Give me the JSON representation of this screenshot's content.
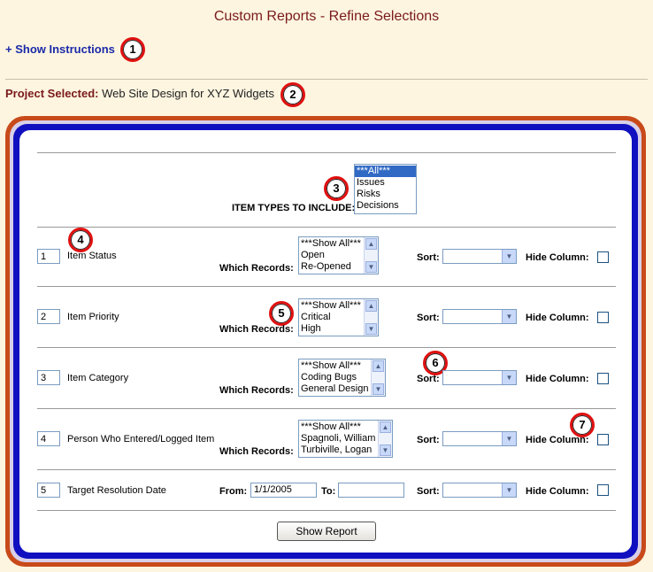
{
  "page": {
    "title": "Custom Reports - Refine Selections",
    "show_instructions": "+ Show Instructions",
    "project_label": "Project Selected:",
    "project_value": "Web Site Design for XYZ Widgets"
  },
  "callouts": [
    "1",
    "2",
    "3",
    "4",
    "5",
    "6",
    "7"
  ],
  "item_types": {
    "label": "ITEM TYPES TO INCLUDE:",
    "options": [
      "***All***",
      "Issues",
      "Risks",
      "Decisions"
    ],
    "selected": "***All***"
  },
  "common": {
    "which_records": "Which Records:",
    "sort": "Sort:",
    "hide_column": "Hide Column:",
    "from": "From:",
    "to": "To:",
    "show_report": "Show Report"
  },
  "rows": [
    {
      "order": "1",
      "label": "Item Status",
      "options": [
        "***Show All***",
        "Open",
        "Re-Opened"
      ]
    },
    {
      "order": "2",
      "label": "Item Priority",
      "options": [
        "***Show All***",
        "Critical",
        "High"
      ]
    },
    {
      "order": "3",
      "label": "Item Category",
      "options": [
        "***Show All***",
        "Coding Bugs",
        "General Design"
      ]
    },
    {
      "order": "4",
      "label": "Person Who Entered/Logged Item",
      "options": [
        "***Show All***",
        "Spagnoli, William",
        "Turbiville, Logan"
      ]
    },
    {
      "order": "5",
      "label": "Target Resolution Date",
      "from_value": "1/1/2005",
      "to_value": ""
    }
  ],
  "icons": {
    "scroll_up": "up-arrow-icon",
    "scroll_down": "down-arrow-icon",
    "dropdown": "chevron-down-icon"
  },
  "colors": {
    "title": "#7a1a1a",
    "link": "#1a2aa8",
    "frame_outer": "#c84a1a",
    "frame_inner": "#1010c0",
    "background": "#fdf5e0",
    "callout_ring": "#e01010"
  }
}
